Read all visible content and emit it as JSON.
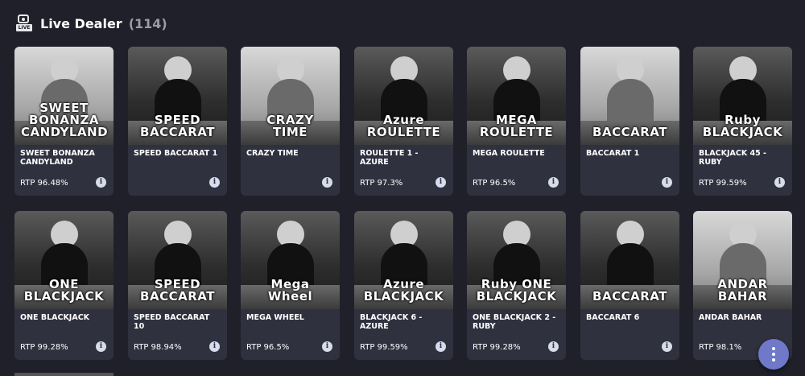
{
  "header": {
    "title": "Live Dealer",
    "count": "(114)",
    "icon": "live-camera-icon",
    "icon_label": "LIVE"
  },
  "games": [
    {
      "name": "SWEET BONANZA CANDYLAND",
      "rtp": "RTP 96.48%",
      "logo": "SWEET BONANZA CANDYLAND",
      "theme": "light"
    },
    {
      "name": "SPEED BACCARAT 1",
      "rtp": "",
      "logo": "SPEED BACCARAT",
      "theme": "dark"
    },
    {
      "name": "CRAZY TIME",
      "rtp": "",
      "logo": "CRAZY TIME",
      "theme": "light"
    },
    {
      "name": "ROULETTE 1 - AZURE",
      "rtp": "RTP 97.3%",
      "logo": "Azure ROULETTE",
      "theme": "dark"
    },
    {
      "name": "MEGA ROULETTE",
      "rtp": "RTP 96.5%",
      "logo": "MEGA ROULETTE",
      "theme": "dark"
    },
    {
      "name": "BACCARAT 1",
      "rtp": "",
      "logo": "BACCARAT",
      "theme": "light"
    },
    {
      "name": "BLACKJACK 45 - RUBY",
      "rtp": "RTP 99.59%",
      "logo": "Ruby BLACKJACK",
      "theme": "dark"
    },
    {
      "name": "ONE BLACKJACK",
      "rtp": "RTP 99.28%",
      "logo": "ONE BLACKJACK",
      "theme": "dark"
    },
    {
      "name": "SPEED BACCARAT 10",
      "rtp": "RTP 98.94%",
      "logo": "SPEED BACCARAT",
      "theme": "dark"
    },
    {
      "name": "MEGA WHEEL",
      "rtp": "RTP 96.5%",
      "logo": "Mega Wheel",
      "theme": "dark"
    },
    {
      "name": "BLACKJACK 6 - AZURE",
      "rtp": "RTP 99.59%",
      "logo": "Azure BLACKJACK",
      "theme": "dark"
    },
    {
      "name": "ONE BLACKJACK 2 - RUBY",
      "rtp": "RTP 99.28%",
      "logo": "Ruby ONE BLACKJACK",
      "theme": "dark"
    },
    {
      "name": "BACCARAT 6",
      "rtp": "",
      "logo": "BACCARAT",
      "theme": "dark"
    },
    {
      "name": "ANDAR BAHAR",
      "rtp": "RTP 98.1%",
      "logo": "ANDAR BAHAR",
      "theme": "light"
    }
  ],
  "info_icon": {
    "glyph": "i",
    "name": "info-icon"
  },
  "fab": {
    "icon": "more-vertical-icon"
  },
  "colors": {
    "background": "#1f2029",
    "card": "#30313f",
    "fab": "#6f78c9",
    "count": "#9a9cab"
  }
}
